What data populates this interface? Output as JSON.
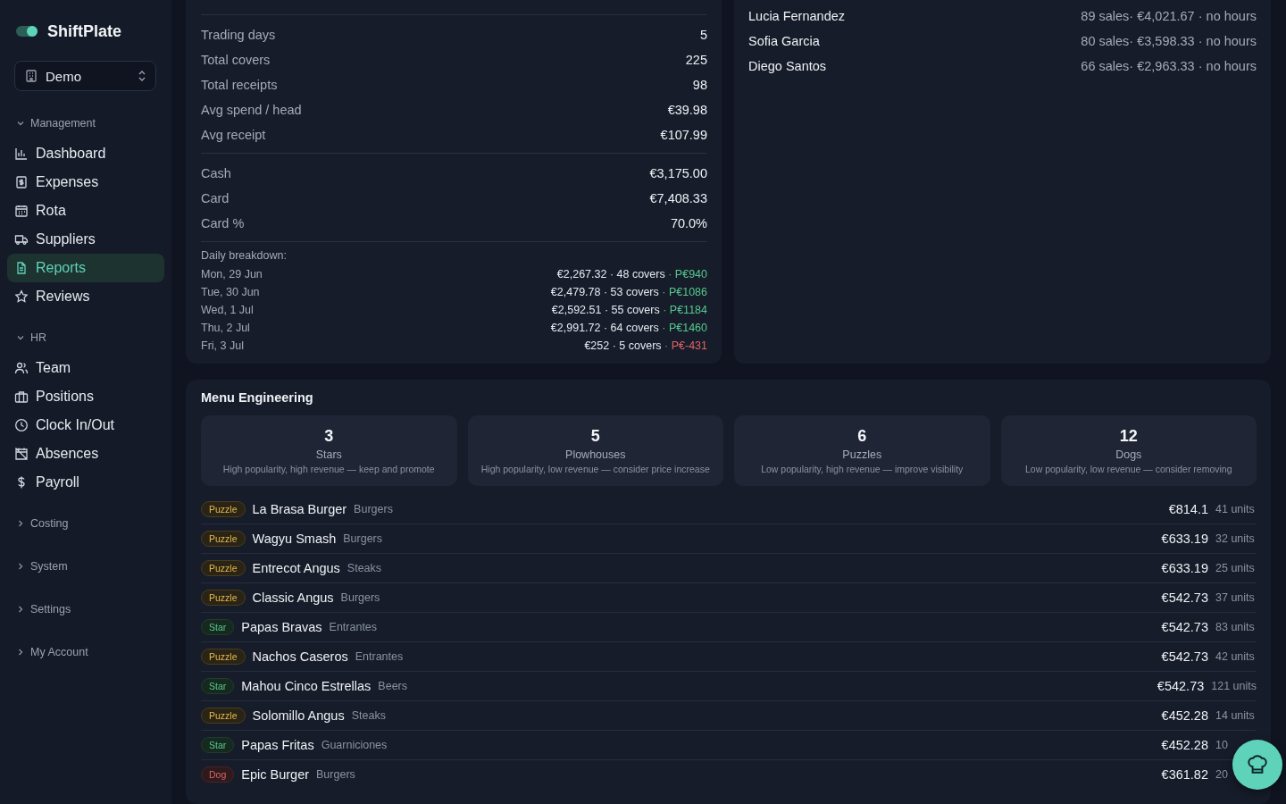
{
  "sidebar": {
    "brand": "ShiftPlate",
    "workspace": "Demo",
    "groups": [
      {
        "label": "Management",
        "expanded": true,
        "items": [
          {
            "label": "Dashboard",
            "selected": false
          },
          {
            "label": "Expenses",
            "selected": false
          },
          {
            "label": "Rota",
            "selected": false
          },
          {
            "label": "Suppliers",
            "selected": false
          },
          {
            "label": "Reports",
            "selected": true
          },
          {
            "label": "Reviews",
            "selected": false
          }
        ]
      },
      {
        "label": "HR",
        "expanded": true,
        "items": [
          {
            "label": "Team",
            "selected": false
          },
          {
            "label": "Positions",
            "selected": false
          },
          {
            "label": "Clock In/Out",
            "selected": false
          },
          {
            "label": "Absences",
            "selected": false
          },
          {
            "label": "Payroll",
            "selected": false
          }
        ]
      },
      {
        "label": "Costing",
        "expanded": false
      },
      {
        "label": "System",
        "expanded": false
      },
      {
        "label": "Settings",
        "expanded": false
      },
      {
        "label": "My Account",
        "expanded": false
      }
    ]
  },
  "summary": {
    "sections": [
      [
        {
          "label": "Trading days",
          "value": "5"
        },
        {
          "label": "Total covers",
          "value": "225"
        },
        {
          "label": "Total receipts",
          "value": "98"
        },
        {
          "label": "Avg spend / head",
          "value": "€39.98"
        },
        {
          "label": "Avg receipt",
          "value": "€107.99"
        }
      ],
      [
        {
          "label": "Cash",
          "value": "€3,175.00"
        },
        {
          "label": "Card",
          "value": "€7,408.33"
        },
        {
          "label": "Card %",
          "value": "70.0%"
        }
      ]
    ],
    "daily_title": "Daily breakdown:",
    "daily": [
      {
        "day": "Mon, 29 Jun",
        "figures": "€2,267.32 · 48 covers",
        "profit": "· P€940",
        "positive": true
      },
      {
        "day": "Tue, 30 Jun",
        "figures": "€2,479.78 · 53 covers",
        "profit": "· P€1086",
        "positive": true
      },
      {
        "day": "Wed, 1 Jul",
        "figures": "€2,592.51 · 55 covers",
        "profit": "· P€1184",
        "positive": true
      },
      {
        "day": "Thu, 2 Jul",
        "figures": "€2,991.72 · 64 covers",
        "profit": "· P€1460",
        "positive": true
      },
      {
        "day": "Fri, 3 Jul",
        "figures": "€252 · 5 covers",
        "profit": "· P€-431",
        "positive": false
      }
    ]
  },
  "staff": [
    {
      "name": "Lucia Fernandez",
      "stats": "89 sales· €4,021.67 · no hours"
    },
    {
      "name": "Sofia Garcia",
      "stats": "80 sales· €3,598.33 · no hours"
    },
    {
      "name": "Diego Santos",
      "stats": "66 sales· €2,963.33 · no hours"
    }
  ],
  "menu_engineering": {
    "title": "Menu Engineering",
    "quadrants": [
      {
        "count": "3",
        "name": "Stars",
        "hint": "High popularity, high revenue — keep and promote"
      },
      {
        "count": "5",
        "name": "Plowhouses",
        "hint": "High popularity, low revenue — consider price increase"
      },
      {
        "count": "6",
        "name": "Puzzles",
        "hint": "Low popularity, high revenue — improve visibility"
      },
      {
        "count": "12",
        "name": "Dogs",
        "hint": "Low popularity, low revenue — consider removing"
      }
    ],
    "items": [
      {
        "kind": "puzzle",
        "badge": "Puzzle",
        "name": "La Brasa Burger",
        "category": "Burgers",
        "revenue": "€814.1",
        "units": "41 units"
      },
      {
        "kind": "puzzle",
        "badge": "Puzzle",
        "name": "Wagyu Smash",
        "category": "Burgers",
        "revenue": "€633.19",
        "units": "32 units"
      },
      {
        "kind": "puzzle",
        "badge": "Puzzle",
        "name": "Entrecot Angus",
        "category": "Steaks",
        "revenue": "€633.19",
        "units": "25 units"
      },
      {
        "kind": "puzzle",
        "badge": "Puzzle",
        "name": "Classic Angus",
        "category": "Burgers",
        "revenue": "€542.73",
        "units": "37 units"
      },
      {
        "kind": "star",
        "badge": "Star",
        "name": "Papas Bravas",
        "category": "Entrantes",
        "revenue": "€542.73",
        "units": "83 units"
      },
      {
        "kind": "puzzle",
        "badge": "Puzzle",
        "name": "Nachos Caseros",
        "category": "Entrantes",
        "revenue": "€542.73",
        "units": "42 units"
      },
      {
        "kind": "star",
        "badge": "Star",
        "name": "Mahou Cinco Estrellas",
        "category": "Beers",
        "revenue": "€542.73",
        "units": "121 units"
      },
      {
        "kind": "puzzle",
        "badge": "Puzzle",
        "name": "Solomillo Angus",
        "category": "Steaks",
        "revenue": "€452.28",
        "units": "14 units"
      },
      {
        "kind": "star",
        "badge": "Star",
        "name": "Papas Fritas",
        "category": "Guarniciones",
        "revenue": "€452.28",
        "units": "10"
      },
      {
        "kind": "dog",
        "badge": "Dog",
        "name": "Epic Burger",
        "category": "Burgers",
        "revenue": "€361.82",
        "units": "20"
      }
    ]
  }
}
